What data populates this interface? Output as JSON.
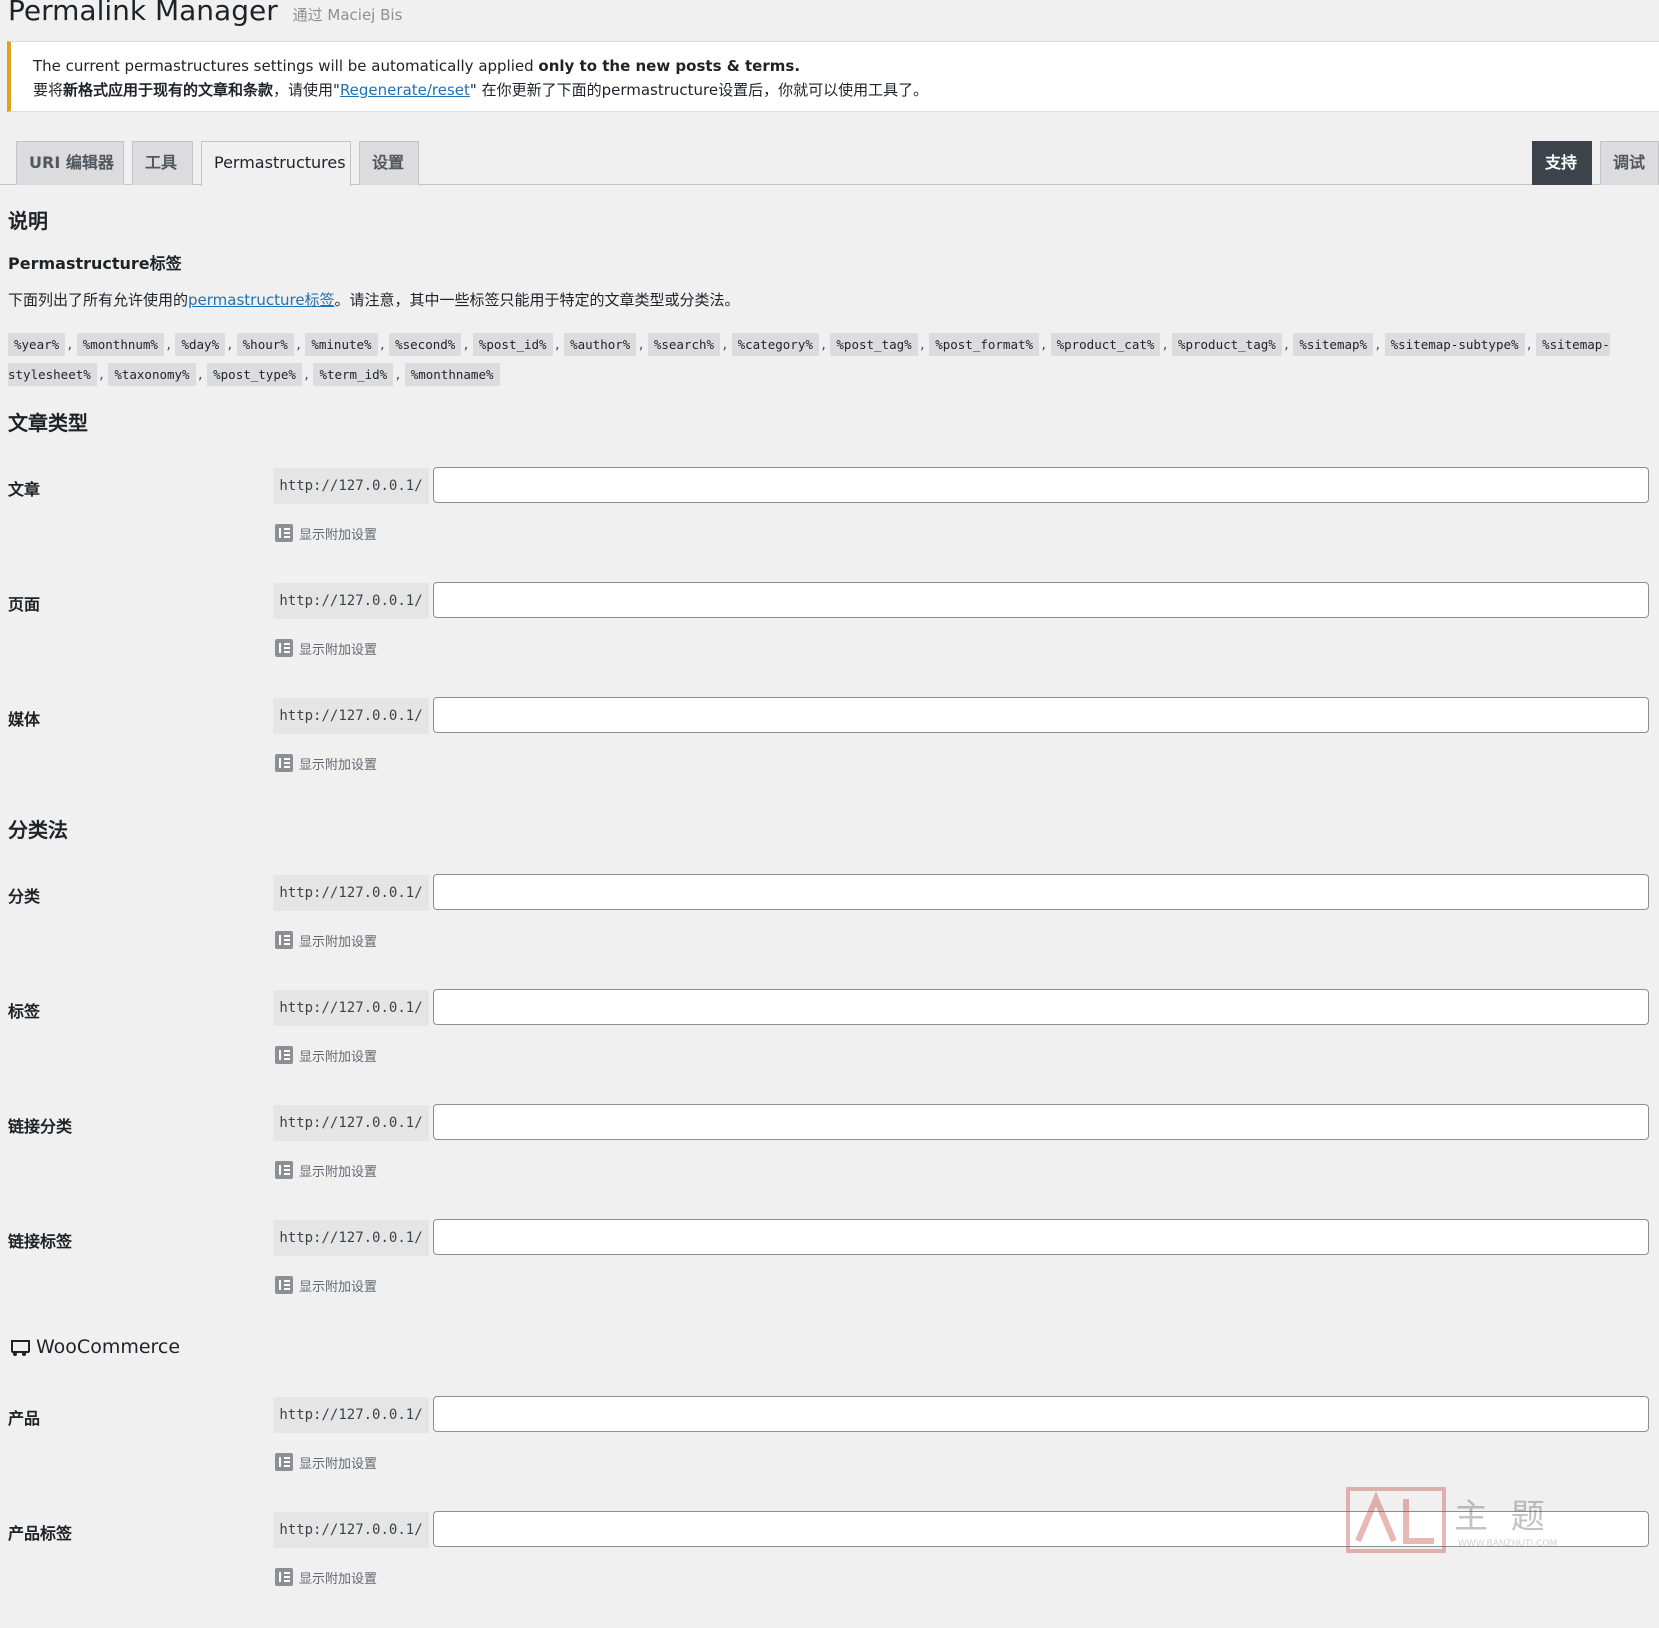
{
  "header": {
    "title": "Permalink Manager",
    "author": "通过 Maciej Bis"
  },
  "notice": {
    "line1_normal": "The current permastructures settings will be automatically applied ",
    "line1_bold": "only to the new posts & terms.",
    "line2_pre": "要将",
    "line2_bold": "新格式应用于现有的文章和条款",
    "line2_mid": "，请使用\"",
    "line2_link": "Regenerate/reset",
    "line2_post": "\" 在你更新了下面的permastructure设置后，你就可以使用工具了。"
  },
  "tabs": {
    "uri_editor": "URI 编辑器",
    "tools": "工具",
    "permastructures": "Permastructures",
    "settings": "设置",
    "support": "支持",
    "debug": "调试"
  },
  "instructions": {
    "heading": "说明",
    "subheading": "Permastructure标签",
    "desc_pre": "下面列出了所有允许使用的",
    "desc_link": "permastructure标签",
    "desc_post": "。请注意，其中一些标签只能用于特定的文章类型或分类法。",
    "tags": [
      "%year%",
      "%monthnum%",
      "%day%",
      "%hour%",
      "%minute%",
      "%second%",
      "%post_id%",
      "%author%",
      "%search%",
      "%category%",
      "%post_tag%",
      "%post_format%",
      "%product_cat%",
      "%product_tag%",
      "%sitemap%",
      "%sitemap-subtype%",
      "%sitemap-stylesheet%",
      "%taxonomy%",
      "%post_type%",
      "%term_id%",
      "%monthname%"
    ]
  },
  "sections": {
    "post_types": "文章类型",
    "taxonomies": "分类法",
    "woocommerce": "WooCommerce"
  },
  "url_prefix": "http://127.0.0.1/",
  "extra_settings_label": "显示附加设置",
  "fields": {
    "post": {
      "label": "文章",
      "value": ""
    },
    "page": {
      "label": "页面",
      "value": ""
    },
    "media": {
      "label": "媒体",
      "value": ""
    },
    "category": {
      "label": "分类",
      "value": ""
    },
    "tag": {
      "label": "标签",
      "value": ""
    },
    "link_category": {
      "label": "链接分类",
      "value": ""
    },
    "link_tag": {
      "label": "链接标签",
      "value": ""
    },
    "product": {
      "label": "产品",
      "value": ""
    },
    "product_tag": {
      "label": "产品标签",
      "value": ""
    }
  },
  "watermark": {
    "text": "主 题",
    "url": "WWW.BANZHUTI.COM"
  },
  "icons": {
    "extra": "expand-settings-icon",
    "woo": "cart-icon"
  },
  "colors": {
    "accent": "#2271b1",
    "notice_border": "#dba617",
    "dark_tab": "#3c434a"
  }
}
